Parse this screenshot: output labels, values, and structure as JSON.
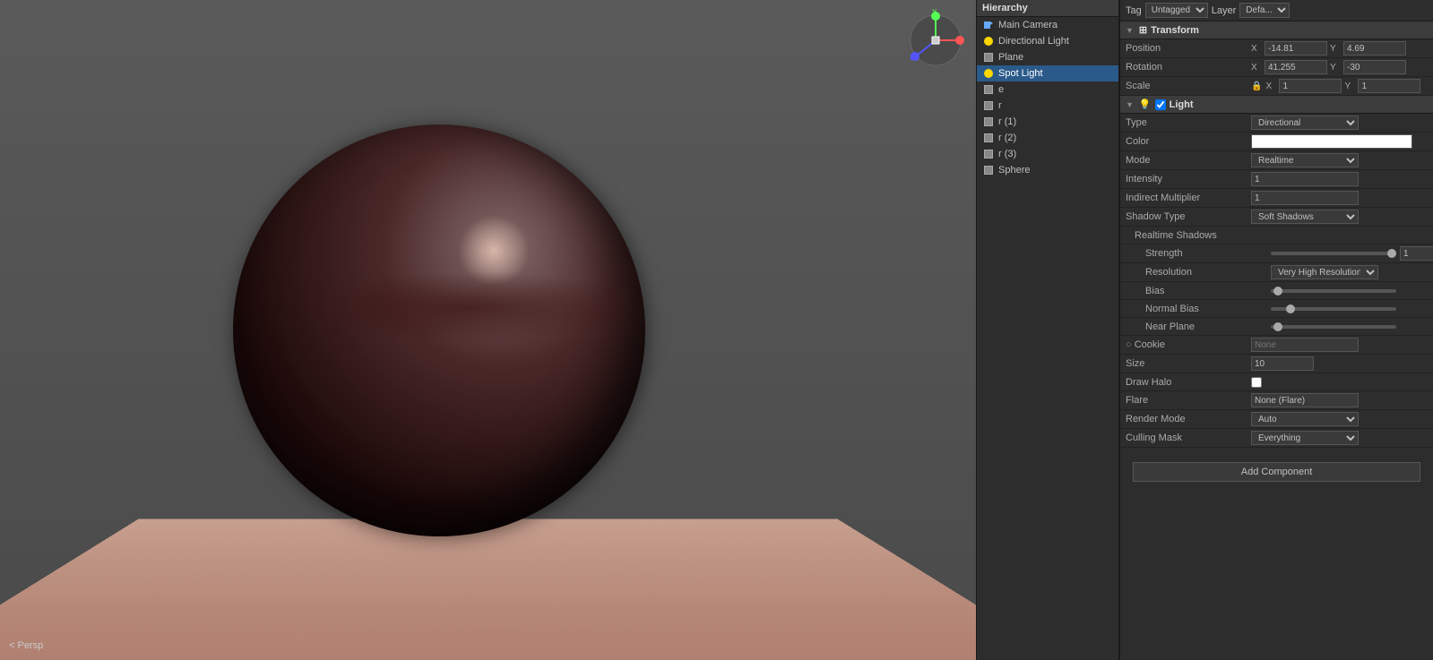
{
  "viewport": {
    "persp_label": "< Persp"
  },
  "hierarchy": {
    "title": "Hierarchy",
    "items": [
      {
        "label": "Main Camera",
        "type": "camera",
        "selected": false
      },
      {
        "label": "Directional Light",
        "type": "light",
        "selected": false
      },
      {
        "label": "Plane",
        "type": "cube",
        "selected": false
      },
      {
        "label": "Spot Light",
        "type": "light",
        "selected": true
      },
      {
        "label": "e",
        "type": "cube",
        "selected": false
      },
      {
        "label": "r",
        "type": "cube",
        "selected": false
      },
      {
        "label": "r (1)",
        "type": "cube",
        "selected": false
      },
      {
        "label": "r (2)",
        "type": "cube",
        "selected": false
      },
      {
        "label": "r (3)",
        "type": "cube",
        "selected": false
      },
      {
        "label": "Sphere",
        "type": "cube",
        "selected": false
      }
    ]
  },
  "inspector": {
    "tag_label": "Tag",
    "tag_value": "Untagged",
    "layer_label": "Layer",
    "layer_value": "Defa...",
    "transform": {
      "section_label": "Transform",
      "position_label": "Position",
      "position_x_label": "X",
      "position_x_value": "-14.81",
      "position_y_label": "Y",
      "position_y_value": "4.69",
      "rotation_label": "Rotation",
      "rotation_x_label": "X",
      "rotation_x_value": "41.255",
      "rotation_y_label": "Y",
      "rotation_y_value": "-30",
      "scale_label": "Scale",
      "scale_x_label": "X",
      "scale_x_value": "1",
      "scale_y_label": "Y",
      "scale_y_value": "1"
    },
    "light": {
      "section_label": "Light",
      "type_label": "Type",
      "type_value": "Directional",
      "color_label": "Color",
      "mode_label": "Mode",
      "mode_value": "Realtime",
      "intensity_label": "Intensity",
      "intensity_value": "1",
      "indirect_multiplier_label": "Indirect Multiplier",
      "indirect_multiplier_value": "1",
      "shadow_type_label": "Shadow Type",
      "shadow_type_value": "Soft Shadows",
      "realtime_shadows_label": "Realtime Shadows",
      "strength_label": "Strength",
      "resolution_label": "Resolution",
      "resolution_value": "Very High Resolution",
      "bias_label": "Bias",
      "normal_bias_label": "Normal Bias",
      "near_plane_label": "Near Plane",
      "cookie_label": "Cookie",
      "size_label": "Size",
      "size_value": "10",
      "draw_halo_label": "Draw Halo",
      "flare_label": "Flare",
      "flare_value": "None (Flare)",
      "render_mode_label": "Render Mode",
      "render_mode_value": "Auto",
      "culling_mask_label": "Culling Mask",
      "culling_mask_value": "Everything",
      "add_component_label": "Add Component"
    }
  }
}
